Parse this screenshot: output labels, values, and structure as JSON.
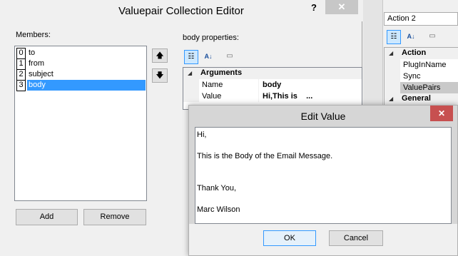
{
  "main": {
    "title": "Valuepair Collection Editor",
    "help": "?",
    "close": "✕",
    "members_label": "Members:",
    "members": [
      {
        "index": "0",
        "name": "to"
      },
      {
        "index": "1",
        "name": "from"
      },
      {
        "index": "2",
        "name": "subject"
      },
      {
        "index": "3",
        "name": "body"
      }
    ],
    "selected_member": "3",
    "up_arrow": "🡅",
    "down_arrow": "🡇",
    "add_label": "Add",
    "remove_label": "Remove",
    "props_label": "body properties:",
    "grid": {
      "category": "Arguments",
      "rows": [
        {
          "name": "Name",
          "value": "body"
        },
        {
          "name": "Value",
          "value": "Hi,This is    ..."
        }
      ]
    }
  },
  "right_panel": {
    "title": "Action 2",
    "categories": [
      {
        "name": "Action",
        "props": [
          "PlugInName",
          "Sync",
          "ValuePairs"
        ]
      },
      {
        "name": "General",
        "props": []
      }
    ],
    "selected_prop": "ValuePairs"
  },
  "edit_dialog": {
    "title": "Edit Value",
    "close": "✕",
    "text": "Hi,\n\nThis is the Body of the Email Message.\n\n\nThank You,\n\nMarc Wilson",
    "ok_label": "OK",
    "cancel_label": "Cancel"
  },
  "icons": {
    "categorized": "categorized-icon",
    "alphabetical": "alphabetical-icon",
    "property_pages": "property-pages-icon"
  },
  "colors": {
    "selection": "#3399ff",
    "close_red": "#c75050"
  }
}
